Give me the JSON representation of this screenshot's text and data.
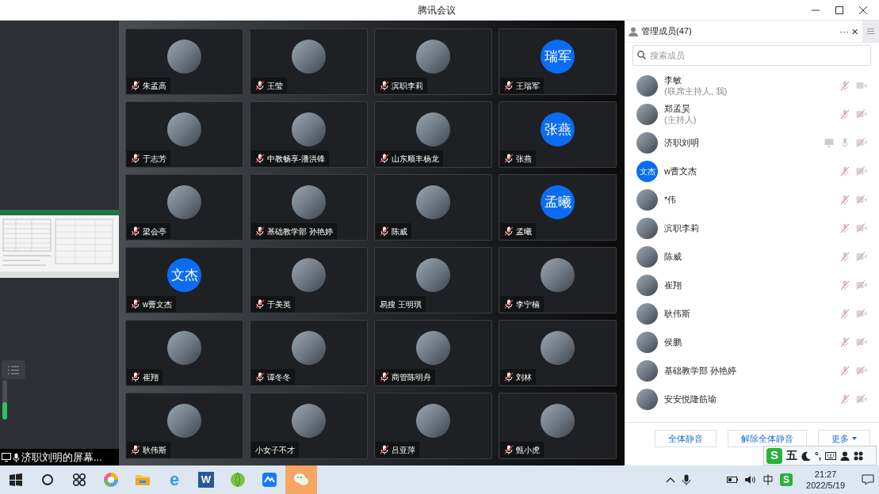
{
  "window": {
    "title": "腾讯会议"
  },
  "share_panel": {
    "label": "济职刘明的屏幕...",
    "level": 0.45
  },
  "tiles": [
    {
      "name": "朱孟高",
      "avatar": {
        "kind": "photo"
      },
      "mic_muted": true
    },
    {
      "name": "王莹",
      "avatar": {
        "kind": "photo"
      },
      "mic_muted": true
    },
    {
      "name": "滨职李莉",
      "avatar": {
        "kind": "photo"
      },
      "mic_muted": true
    },
    {
      "name": "王瑞军",
      "avatar": {
        "kind": "initials",
        "text": "瑞军"
      },
      "mic_muted": true
    },
    {
      "name": "于志芳",
      "avatar": {
        "kind": "photo"
      },
      "mic_muted": true
    },
    {
      "name": "中教畅享-潘洪锋",
      "avatar": {
        "kind": "photo"
      },
      "mic_muted": true
    },
    {
      "name": "山东顺丰杨龙",
      "avatar": {
        "kind": "photo"
      },
      "mic_muted": true
    },
    {
      "name": "张燕",
      "avatar": {
        "kind": "initials",
        "text": "张燕"
      },
      "mic_muted": true
    },
    {
      "name": "梁会亭",
      "avatar": {
        "kind": "photo"
      },
      "mic_muted": true
    },
    {
      "name": "基础教学部 孙艳婷",
      "avatar": {
        "kind": "photo"
      },
      "mic_muted": true
    },
    {
      "name": "陈威",
      "avatar": {
        "kind": "photo"
      },
      "mic_muted": true
    },
    {
      "name": "孟曦",
      "avatar": {
        "kind": "initials",
        "text": "孟曦"
      },
      "mic_muted": true
    },
    {
      "name": "w曹文杰",
      "avatar": {
        "kind": "initials",
        "text": "文杰"
      },
      "mic_muted": true
    },
    {
      "name": "于美英",
      "avatar": {
        "kind": "photo"
      },
      "mic_muted": true
    },
    {
      "name": "易搜 王明琪",
      "avatar": {
        "kind": "photo"
      },
      "mic_muted": false
    },
    {
      "name": "李宁楠",
      "avatar": {
        "kind": "photo"
      },
      "mic_muted": true
    },
    {
      "name": "崔翔",
      "avatar": {
        "kind": "photo"
      },
      "mic_muted": true
    },
    {
      "name": "谭冬冬",
      "avatar": {
        "kind": "photo"
      },
      "mic_muted": true
    },
    {
      "name": "商管陈明舟",
      "avatar": {
        "kind": "photo"
      },
      "mic_muted": true
    },
    {
      "name": "刘林",
      "avatar": {
        "kind": "photo"
      },
      "mic_muted": true
    },
    {
      "name": "耿伟斯",
      "avatar": {
        "kind": "photo"
      },
      "mic_muted": true
    },
    {
      "name": "小女子不才",
      "avatar": {
        "kind": "photo"
      },
      "mic_muted": false
    },
    {
      "name": "吕亚萍",
      "avatar": {
        "kind": "photo"
      },
      "mic_muted": true
    },
    {
      "name": "甄小虎",
      "avatar": {
        "kind": "photo"
      },
      "mic_muted": true
    }
  ],
  "members": {
    "title": "管理成员(47)",
    "more_menu": "···",
    "close": "×",
    "search": {
      "placeholder": "搜索成员"
    },
    "items": [
      {
        "name": "李敏",
        "role": "(联席主持人, 我)",
        "avatar": {
          "kind": "photo"
        },
        "sharing": false,
        "mic_muted": true,
        "camera_off": false
      },
      {
        "name": "郑孟昊",
        "role": "(主持人)",
        "avatar": {
          "kind": "photo"
        },
        "sharing": false,
        "mic_muted": true,
        "camera_off": true
      },
      {
        "name": "济职刘明",
        "avatar": {
          "kind": "photo"
        },
        "sharing": true,
        "mic_muted": false,
        "camera_off": true
      },
      {
        "name": "w曹文杰",
        "avatar": {
          "kind": "initials",
          "text": "文杰"
        },
        "sharing": false,
        "mic_muted": true,
        "camera_off": true
      },
      {
        "name": "*伟",
        "avatar": {
          "kind": "photo"
        },
        "sharing": false,
        "mic_muted": true,
        "camera_off": true
      },
      {
        "name": "滨职李莉",
        "avatar": {
          "kind": "photo"
        },
        "sharing": false,
        "mic_muted": true,
        "camera_off": true
      },
      {
        "name": "陈威",
        "avatar": {
          "kind": "photo"
        },
        "sharing": false,
        "mic_muted": true,
        "camera_off": true
      },
      {
        "name": "崔翔",
        "avatar": {
          "kind": "photo"
        },
        "sharing": false,
        "mic_muted": true,
        "camera_off": true
      },
      {
        "name": "耿伟斯",
        "avatar": {
          "kind": "photo"
        },
        "sharing": false,
        "mic_muted": true,
        "camera_off": true
      },
      {
        "name": "侯鹏",
        "avatar": {
          "kind": "photo"
        },
        "sharing": false,
        "mic_muted": true,
        "camera_off": true
      },
      {
        "name": "基础教学部 孙艳婷",
        "avatar": {
          "kind": "photo"
        },
        "sharing": false,
        "mic_muted": true,
        "camera_off": true
      },
      {
        "name": "安安悦隆筋瑜",
        "avatar": {
          "kind": "photo"
        },
        "sharing": false,
        "mic_muted": true,
        "camera_off": true
      }
    ],
    "buttons": [
      {
        "label": "全体静音",
        "kind": "plain"
      },
      {
        "label": "解除全体静音",
        "kind": "plain"
      },
      {
        "label": "更多",
        "kind": "dropdown"
      }
    ]
  },
  "ime_bar": {
    "logo": "S",
    "mode": "五",
    "punctuation": "°,"
  },
  "taskbar": {
    "apps": [
      {
        "kind": "start",
        "selected": false
      },
      {
        "kind": "search",
        "selected": false
      },
      {
        "kind": "taskview",
        "selected": false
      },
      {
        "kind": "colorwheel",
        "selected": false
      },
      {
        "kind": "folder",
        "selected": false
      },
      {
        "kind": "ie",
        "glyph": "e",
        "selected": false
      },
      {
        "kind": "word",
        "glyph": "W",
        "selected": false
      },
      {
        "kind": "ball",
        "selected": false
      },
      {
        "kind": "meeting",
        "selected": false
      },
      {
        "kind": "wechat",
        "selected": true
      }
    ],
    "tray_logo": "S",
    "time": "21:27",
    "date": "2022/5/19"
  }
}
